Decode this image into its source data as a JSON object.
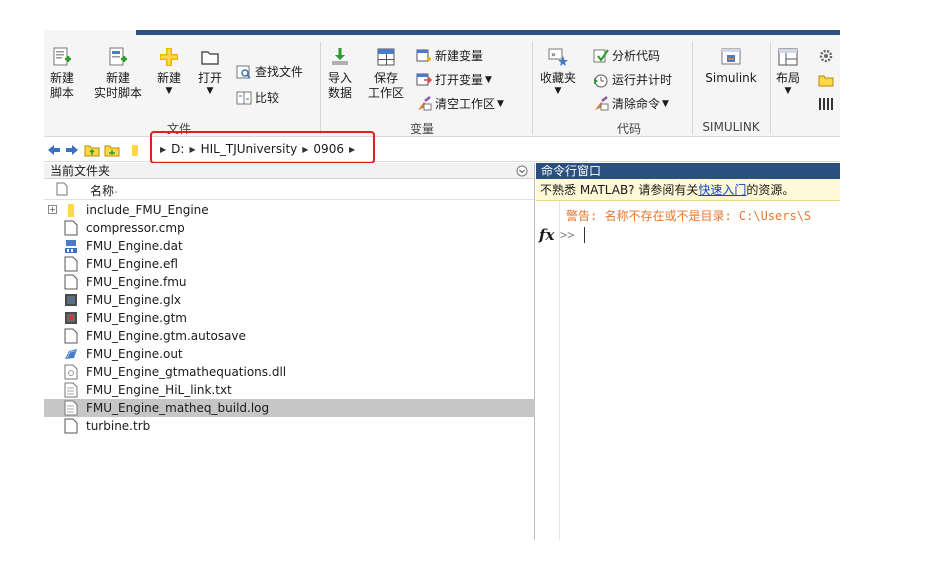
{
  "ribbon": {
    "groups": {
      "file": "文件",
      "variable": "变量",
      "code": "代码",
      "simulink": "SIMULINK"
    },
    "new_script": [
      "新建",
      "脚本"
    ],
    "new_live_script": [
      "新建",
      "实时脚本"
    ],
    "new": "新建",
    "open": "打开",
    "find_files": "查找文件",
    "compare": "比较",
    "import_data": [
      "导入",
      "数据"
    ],
    "save_workspace": [
      "保存",
      "工作区"
    ],
    "new_variable": "新建变量",
    "open_variable": "打开变量",
    "clear_workspace": "清空工作区",
    "favorites": "收藏夹",
    "analyze_code": "分析代码",
    "run_and_time": "运行并计时",
    "clear_commands": "清除命令",
    "simulink": "Simulink",
    "layout": "布局",
    "caret": "▼"
  },
  "address": {
    "crumbs": [
      "D:",
      "HIL_TJUniversity",
      "0906"
    ],
    "separator": "▶"
  },
  "file_panel": {
    "title": "当前文件夹",
    "column_name": "名称",
    "sort_indicator": "-",
    "expand_symbol": "+",
    "files": [
      {
        "name": "include_FMU_Engine",
        "icon": "folder-icon"
      },
      {
        "name": "compressor.cmp",
        "icon": "document-icon"
      },
      {
        "name": "FMU_Engine.dat",
        "icon": "data-file-icon"
      },
      {
        "name": "FMU_Engine.efl",
        "icon": "document-icon"
      },
      {
        "name": "FMU_Engine.fmu",
        "icon": "document-icon"
      },
      {
        "name": "FMU_Engine.glx",
        "icon": "gt-blue-icon"
      },
      {
        "name": "FMU_Engine.gtm",
        "icon": "gt-red-icon"
      },
      {
        "name": "FMU_Engine.gtm.autosave",
        "icon": "document-icon"
      },
      {
        "name": "FMU_Engine.out",
        "icon": "output-file-icon"
      },
      {
        "name": "FMU_Engine_gtmathequations.dll",
        "icon": "dll-file-icon"
      },
      {
        "name": "FMU_Engine_HiL_link.txt",
        "icon": "text-file-icon"
      },
      {
        "name": "FMU_Engine_matheq_build.log",
        "icon": "text-file-icon"
      },
      {
        "name": "turbine.trb",
        "icon": "document-icon"
      }
    ],
    "selected_index": 11
  },
  "command_window": {
    "title": "命令行窗口",
    "banner_prefix": "不熟悉 MATLAB? 请参阅有关",
    "banner_link": "快速入门",
    "banner_suffix": "的资源。",
    "warning": "警告: 名称不存在或不是目录: C:\\Users\\S",
    "fx": "fx",
    "prompt": ">>"
  },
  "colors": {
    "accent_blue": "#2b4f7e",
    "highlight_red": "#e0201d",
    "warning_orange": "#e8772e",
    "link_blue": "#0b46c4"
  }
}
